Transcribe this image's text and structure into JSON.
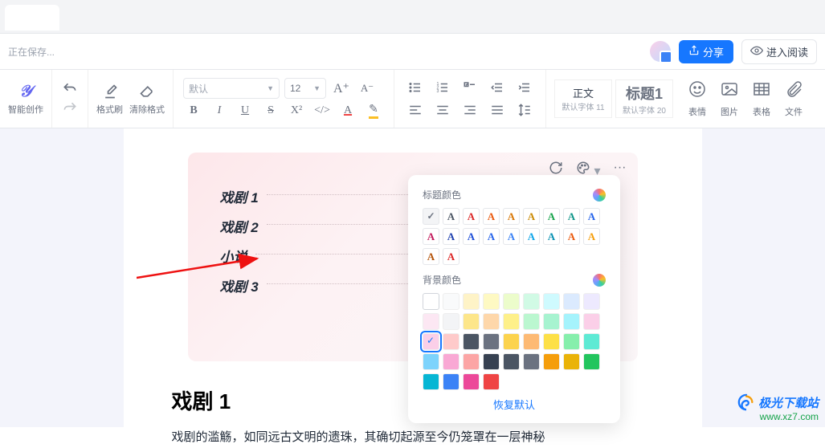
{
  "tabbar": {},
  "topbar": {
    "saving_text": "正在保存...",
    "share_label": "分享",
    "read_label": "进入阅读"
  },
  "toolbar": {
    "smart_label": "智能创作",
    "brush_label": "格式刷",
    "clear_label": "清除格式",
    "font_placeholder": "默认",
    "font_size": "12",
    "style_normal": "正文",
    "style_normal_sub": "默认字体 11",
    "style_h1": "标题1",
    "style_h1_sub": "默认字体 20",
    "emoji_label": "表情",
    "image_label": "图片",
    "table_label": "表格",
    "file_label": "文件"
  },
  "toc": {
    "items": [
      "戏剧 1",
      "戏剧 2",
      "小说",
      "戏剧 3"
    ]
  },
  "popover": {
    "title_color_label": "标题颜色",
    "title_colors_row1": [
      "#9ca3af",
      "#4b5563",
      "#dc2626",
      "#ea580c",
      "#d97706",
      "#ca8a04",
      "#16a34a",
      "#0d9488",
      "#2563eb",
      "#c2185b"
    ],
    "title_colors_row2": [
      "#1e40af",
      "#1d4ed8",
      "#2563eb",
      "#3b82f6",
      "#0ea5e9",
      "#0891b2",
      "#ea580c",
      "#f59e0b",
      "#b45309",
      "#dc2626"
    ],
    "bg_color_label": "背景颜色",
    "bg_row1": [
      "#ffffff",
      "#f9fafb",
      "#fef3c7",
      "#fef9c3",
      "#ecfccb",
      "#d1fae5",
      "#cffafe",
      "#dbeafe",
      "#ede9fe",
      "#fce7f3"
    ],
    "bg_row2": [
      "#f3f4f6",
      "#fde68a",
      "#fed7aa",
      "#fef08a",
      "#bbf7d0",
      "#a7f3d0",
      "#a5f3fc",
      "#fbcfe8",
      "#fbcfe8",
      "#fecaca"
    ],
    "bg_row2_selected_index": 8,
    "bg_row3": [
      "#4b5563",
      "#6b7280",
      "#fcd34d",
      "#fdba74",
      "#fde047",
      "#86efac",
      "#5eead4",
      "#7dd3fc",
      "#f9a8d4",
      "#fca5a5"
    ],
    "bg_row4": [
      "#374151",
      "#4b5563",
      "#6b7280",
      "#f59e0b",
      "#eab308",
      "#22c55e",
      "#06b6d4",
      "#3b82f6",
      "#ec4899",
      "#ef4444"
    ],
    "restore_label": "恢复默认"
  },
  "article": {
    "heading": "戏剧 1",
    "body": "戏剧的滥觞，如同远古文明的遗珠，其确切起源至今仍笼罩在一层神秘"
  },
  "watermark": {
    "name": "极光下载站",
    "url": "www.xz7.com"
  }
}
